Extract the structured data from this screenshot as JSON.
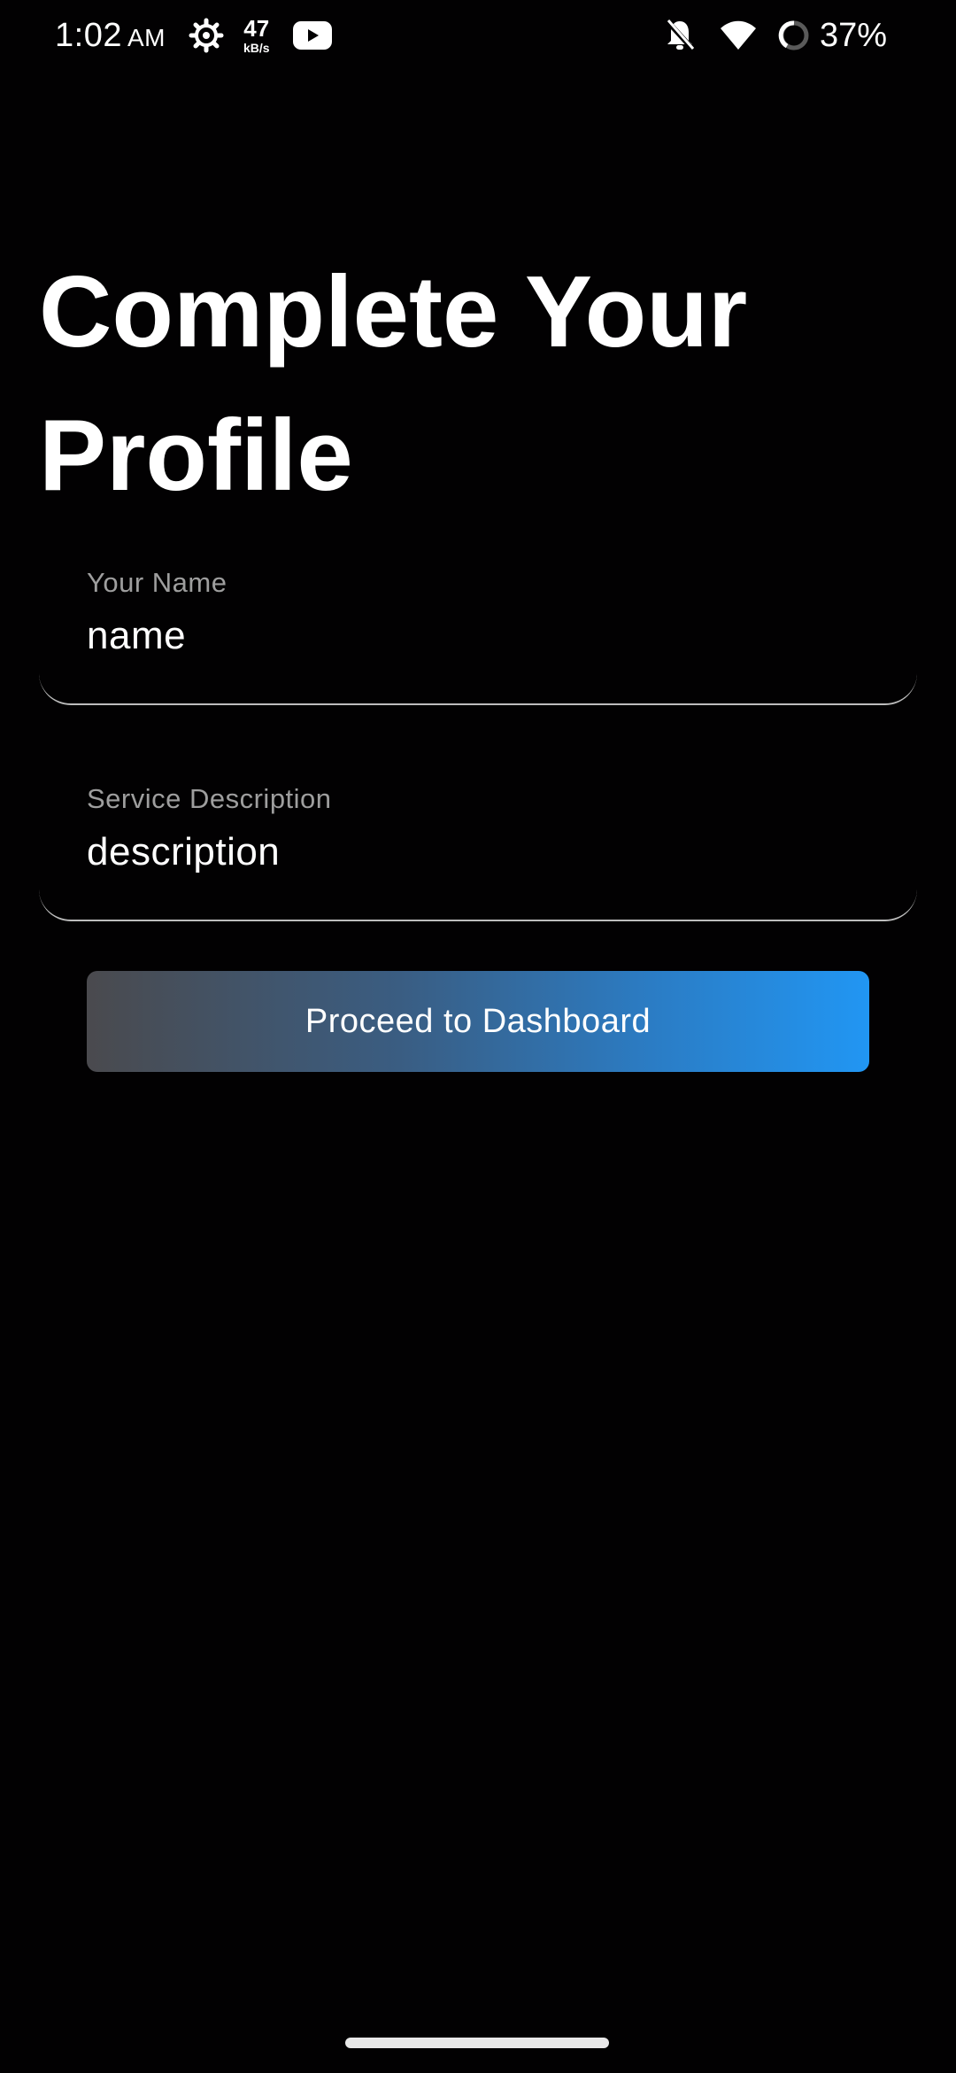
{
  "status_bar": {
    "time": "1:02",
    "ampm": "AM",
    "net_speed_value": "47",
    "net_speed_unit": "kB/s",
    "battery_percent": "37%"
  },
  "page": {
    "title": "Complete Your Profile"
  },
  "form": {
    "name_field": {
      "label": "Your Name",
      "value": "name"
    },
    "description_field": {
      "label": "Service Description",
      "value": "description"
    },
    "proceed_label": "Proceed to Dashboard"
  },
  "colors": {
    "background": "#020102",
    "button_gradient_start": "#4a4a4e",
    "button_gradient_end": "#2196f3",
    "field_underline": "#bdbdbd",
    "label_text": "#9e9e9e"
  }
}
